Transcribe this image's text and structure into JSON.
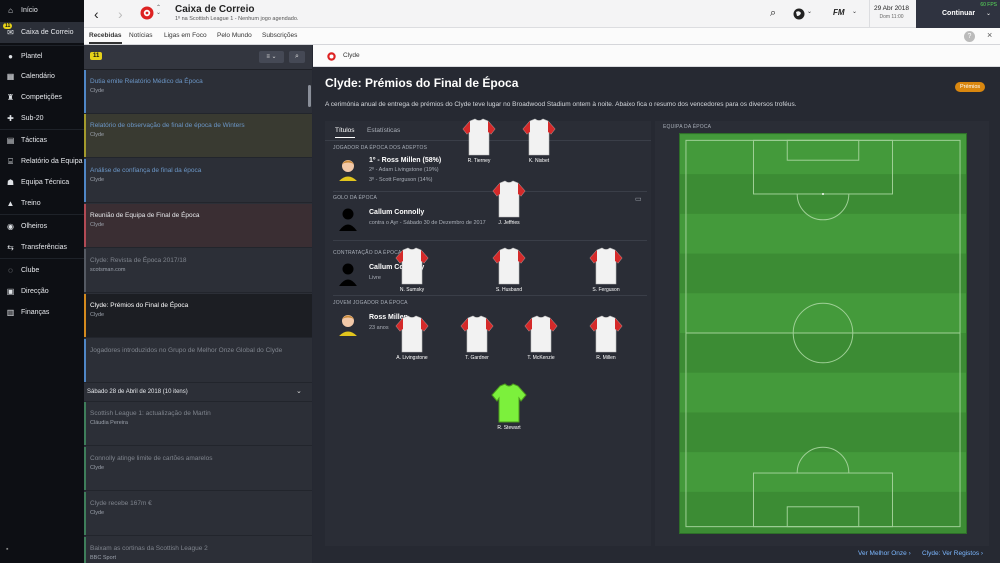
{
  "sidebar": {
    "items": [
      {
        "label": "Início",
        "icon": "home-icon"
      },
      {
        "label": "Caixa de Correio",
        "icon": "inbox-icon",
        "badge": "11"
      },
      {
        "label": "Plantel",
        "icon": "squad-icon"
      },
      {
        "label": "Calendário",
        "icon": "calendar-icon"
      },
      {
        "label": "Competições",
        "icon": "trophy-icon"
      },
      {
        "label": "Sub-20",
        "icon": "youth-icon"
      },
      {
        "label": "Tácticas",
        "icon": "tactics-icon"
      },
      {
        "label": "Relatório da Equipa",
        "icon": "report-icon"
      },
      {
        "label": "Equipa Técnica",
        "icon": "staff-icon"
      },
      {
        "label": "Treino",
        "icon": "training-icon"
      },
      {
        "label": "Olheiros",
        "icon": "scouting-icon"
      },
      {
        "label": "Transferências",
        "icon": "transfers-icon"
      },
      {
        "label": "Clube",
        "icon": "club-icon"
      },
      {
        "label": "Direcção",
        "icon": "board-icon"
      },
      {
        "label": "Finanças",
        "icon": "finances-icon"
      }
    ]
  },
  "header": {
    "title": "Caixa de Correio",
    "subtitle": "1º na Scottish League 1 - Nenhum jogo agendado.",
    "date": "29 Abr 2018",
    "time": "Dom 11:00",
    "continue_label": "Continuar",
    "fps": "60 FPS",
    "fm_label": "FM"
  },
  "tabs": [
    "Recebidas",
    "Notícias",
    "Ligas em Foco",
    "Pelo Mundo",
    "Subscrições"
  ],
  "list": {
    "count_badge": "11",
    "messages": [
      {
        "title": "Dutia emite Relatório Médico da Época",
        "sub": "Clyde",
        "color": "#6b96c6",
        "bg": "#2c2f37",
        "bar": "#4f86c6"
      },
      {
        "title": "Relatório de observação de final de época de Winters",
        "sub": "Clyde",
        "color": "#6b96c6",
        "bg": "#393a31",
        "bar": "#a39a2c"
      },
      {
        "title": "Análise de confiança de final da época",
        "sub": "Clyde",
        "color": "#6b96c6",
        "bg": "#2c2f37",
        "bar": "#4f86c6"
      },
      {
        "title": "Reunião de Equipa de Final de Época",
        "sub": "Clyde",
        "color": "#e9ebee",
        "bg": "#3a2e33",
        "bar": "#b24a55"
      },
      {
        "title": "Clyde: Revista de Época 2017/18",
        "sub": "scotsman.com",
        "color": "#7f848d",
        "bg": "#2c2f37",
        "bar": "#555a63"
      },
      {
        "title": "Clyde: Prémios do Final de Época",
        "sub": "Clyde",
        "color": "#ffffff",
        "bg": "#1c1e23",
        "bar": "#d48a1e"
      },
      {
        "title": "Jogadores introduzidos no Grupo de Melhor Onze Global do Clyde",
        "sub": "",
        "color": "#7f848d",
        "bg": "#2c2f37",
        "bar": "#4f86c6"
      }
    ],
    "day_header": "Sábado 28 de Abril de 2018 (10 itens)",
    "older": [
      {
        "title": "Scottish League 1: actualização de Martin",
        "sub": "Cláudia Pereira",
        "color": "#7f848d",
        "bar": "#3e7e5a"
      },
      {
        "title": "Connolly atinge limite de cartões amarelos",
        "sub": "Clyde",
        "color": "#7f848d",
        "bar": "#3e7e5a"
      },
      {
        "title": "Clyde recebe 167m €",
        "sub": "Clyde",
        "color": "#7f848d",
        "bar": "#3e7e5a"
      },
      {
        "title": "Baixam as cortinas da Scottish League 2",
        "sub": "BBC Sport",
        "color": "#7f848d",
        "bar": "#3e7e5a"
      }
    ]
  },
  "detail": {
    "club": "Clyde",
    "title": "Clyde: Prémios do Final de Época",
    "tag": "Prémios",
    "intro": "A cerimónia anual de entrega de prémios do Clyde teve lugar no Broadwood Stadium ontem à noite. Abaixo fica o resumo dos vencedores para os diversos troféus.",
    "tabs": [
      "Títulos",
      "Estatísticas"
    ],
    "awards": [
      {
        "label": "Jogador da Época dos Adeptos",
        "lines": [
          "1º - Ross Millen (58%)",
          "2º - Adam Livingstone (19%)",
          "3º - Scott Ferguson (14%)"
        ]
      },
      {
        "label": "Golo da Época",
        "lines": [
          "Callum Connolly",
          "contra o Ayr - Sábado 30 de Dezembro de 2017"
        ]
      },
      {
        "label": "Contratação da Época",
        "lines": [
          "Callum Connolly",
          "Livre"
        ]
      },
      {
        "label": "Jovem Jogador da Época",
        "lines": [
          "Ross Millen",
          "23 anos"
        ]
      }
    ],
    "team_label": "Equipa da Época",
    "players": [
      "R. Tierney",
      "K. Nisbet",
      "J. Jeffries",
      "N. Sumsky",
      "S. Husband",
      "S. Ferguson",
      "A. Livingstone",
      "T. Gardner",
      "T. McKenzie",
      "R. Millen",
      "R. Stewart"
    ],
    "links": [
      "Ver Melhor Onze",
      "Clyde: Ver Registos"
    ]
  }
}
